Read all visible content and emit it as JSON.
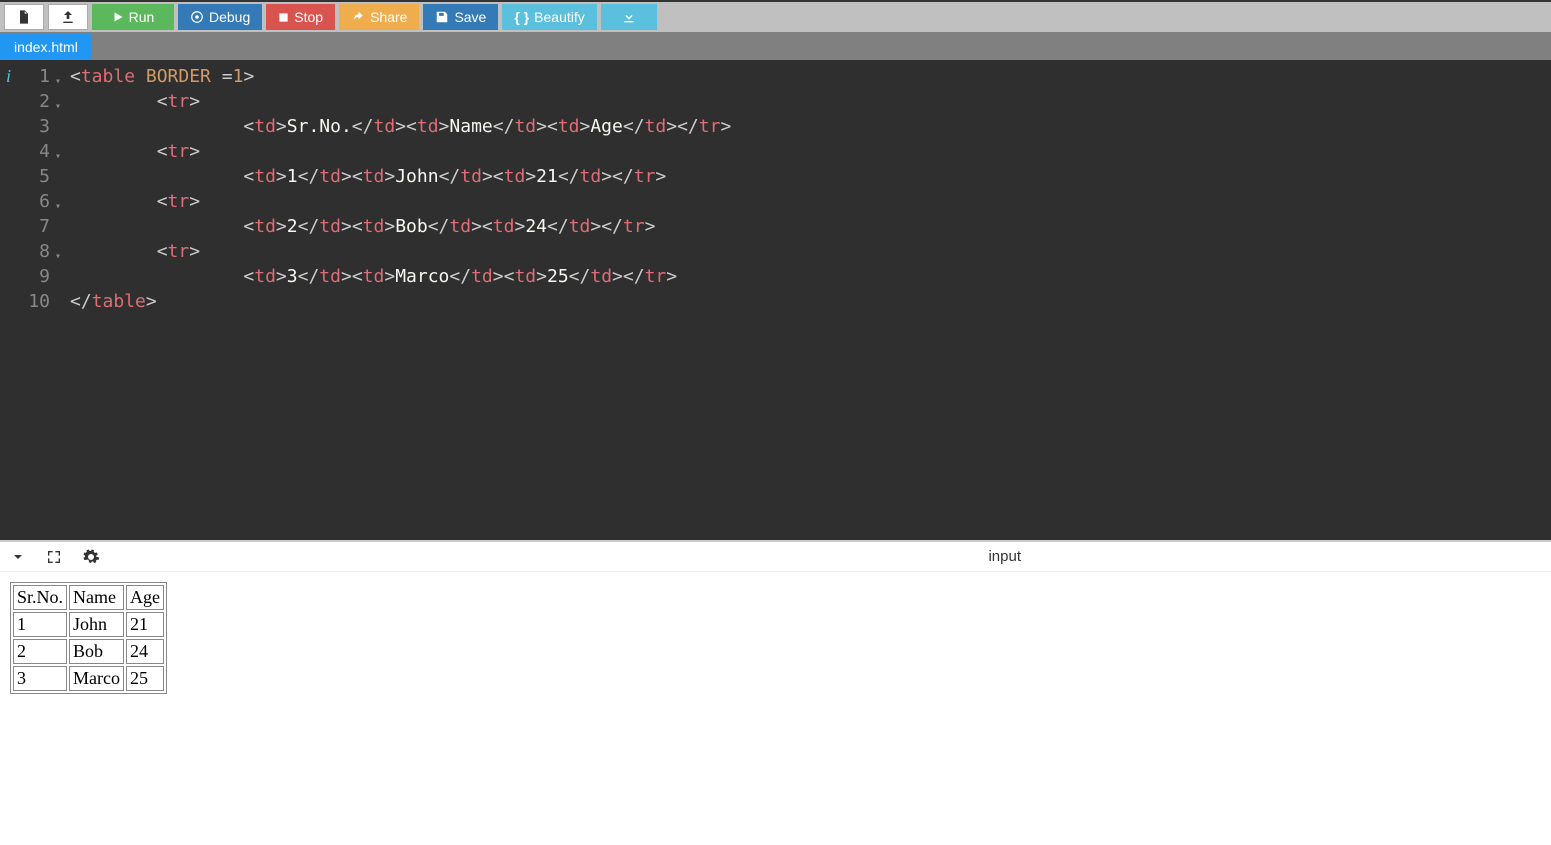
{
  "toolbar": {
    "run": "Run",
    "debug": "Debug",
    "stop": "Stop",
    "share": "Share",
    "save": "Save",
    "beautify": "Beautify"
  },
  "tab": {
    "name": "index.html"
  },
  "editor": {
    "lines": [
      {
        "n": "1",
        "fold": true,
        "info": true,
        "indent": 0,
        "tokens": [
          [
            "punc",
            "<"
          ],
          [
            "tag",
            "table"
          ],
          [
            "txt",
            " "
          ],
          [
            "attr",
            "BORDER"
          ],
          [
            "txt",
            " "
          ],
          [
            "punc",
            "="
          ],
          [
            "num",
            "1"
          ],
          [
            "punc",
            ">"
          ]
        ]
      },
      {
        "n": "2",
        "fold": true,
        "indent": 2,
        "tokens": [
          [
            "punc",
            "<"
          ],
          [
            "tag",
            "tr"
          ],
          [
            "punc",
            ">"
          ]
        ]
      },
      {
        "n": "3",
        "indent": 4,
        "tokens": [
          [
            "punc",
            "<"
          ],
          [
            "tag",
            "td"
          ],
          [
            "punc",
            ">"
          ],
          [
            "txt",
            "Sr.No."
          ],
          [
            "punc",
            "</"
          ],
          [
            "tag",
            "td"
          ],
          [
            "punc",
            "><"
          ],
          [
            "tag",
            "td"
          ],
          [
            "punc",
            ">"
          ],
          [
            "txt",
            "Name"
          ],
          [
            "punc",
            "</"
          ],
          [
            "tag",
            "td"
          ],
          [
            "punc",
            "><"
          ],
          [
            "tag",
            "td"
          ],
          [
            "punc",
            ">"
          ],
          [
            "txt",
            "Age"
          ],
          [
            "punc",
            "</"
          ],
          [
            "tag",
            "td"
          ],
          [
            "punc",
            "></"
          ],
          [
            "tag",
            "tr"
          ],
          [
            "punc",
            ">"
          ]
        ]
      },
      {
        "n": "4",
        "fold": true,
        "indent": 2,
        "tokens": [
          [
            "punc",
            "<"
          ],
          [
            "tag",
            "tr"
          ],
          [
            "punc",
            ">"
          ]
        ]
      },
      {
        "n": "5",
        "indent": 4,
        "tokens": [
          [
            "punc",
            "<"
          ],
          [
            "tag",
            "td"
          ],
          [
            "punc",
            ">"
          ],
          [
            "txt",
            "1"
          ],
          [
            "punc",
            "</"
          ],
          [
            "tag",
            "td"
          ],
          [
            "punc",
            "><"
          ],
          [
            "tag",
            "td"
          ],
          [
            "punc",
            ">"
          ],
          [
            "txt",
            "John"
          ],
          [
            "punc",
            "</"
          ],
          [
            "tag",
            "td"
          ],
          [
            "punc",
            "><"
          ],
          [
            "tag",
            "td"
          ],
          [
            "punc",
            ">"
          ],
          [
            "txt",
            "21"
          ],
          [
            "punc",
            "</"
          ],
          [
            "tag",
            "td"
          ],
          [
            "punc",
            "></"
          ],
          [
            "tag",
            "tr"
          ],
          [
            "punc",
            ">"
          ]
        ]
      },
      {
        "n": "6",
        "fold": true,
        "indent": 2,
        "tokens": [
          [
            "punc",
            "<"
          ],
          [
            "tag",
            "tr"
          ],
          [
            "punc",
            ">"
          ]
        ]
      },
      {
        "n": "7",
        "indent": 4,
        "tokens": [
          [
            "punc",
            "<"
          ],
          [
            "tag",
            "td"
          ],
          [
            "punc",
            ">"
          ],
          [
            "txt",
            "2"
          ],
          [
            "punc",
            "</"
          ],
          [
            "tag",
            "td"
          ],
          [
            "punc",
            "><"
          ],
          [
            "tag",
            "td"
          ],
          [
            "punc",
            ">"
          ],
          [
            "txt",
            "Bob"
          ],
          [
            "punc",
            "</"
          ],
          [
            "tag",
            "td"
          ],
          [
            "punc",
            "><"
          ],
          [
            "tag",
            "td"
          ],
          [
            "punc",
            ">"
          ],
          [
            "txt",
            "24"
          ],
          [
            "punc",
            "</"
          ],
          [
            "tag",
            "td"
          ],
          [
            "punc",
            "></"
          ],
          [
            "tag",
            "tr"
          ],
          [
            "punc",
            ">"
          ]
        ]
      },
      {
        "n": "8",
        "fold": true,
        "indent": 2,
        "tokens": [
          [
            "punc",
            "<"
          ],
          [
            "tag",
            "tr"
          ],
          [
            "punc",
            ">"
          ]
        ]
      },
      {
        "n": "9",
        "indent": 4,
        "tokens": [
          [
            "punc",
            "<"
          ],
          [
            "tag",
            "td"
          ],
          [
            "punc",
            ">"
          ],
          [
            "txt",
            "3"
          ],
          [
            "punc",
            "</"
          ],
          [
            "tag",
            "td"
          ],
          [
            "punc",
            "><"
          ],
          [
            "tag",
            "td"
          ],
          [
            "punc",
            ">"
          ],
          [
            "txt",
            "Marco"
          ],
          [
            "punc",
            "</"
          ],
          [
            "tag",
            "td"
          ],
          [
            "punc",
            "><"
          ],
          [
            "tag",
            "td"
          ],
          [
            "punc",
            ">"
          ],
          [
            "txt",
            "25"
          ],
          [
            "punc",
            "</"
          ],
          [
            "tag",
            "td"
          ],
          [
            "punc",
            "></"
          ],
          [
            "tag",
            "tr"
          ],
          [
            "punc",
            ">"
          ]
        ]
      },
      {
        "n": "10",
        "indent": 0,
        "tokens": [
          [
            "punc",
            "</"
          ],
          [
            "tag",
            "table"
          ],
          [
            "punc",
            ">"
          ]
        ]
      }
    ]
  },
  "outputBar": {
    "inputLabel": "input"
  },
  "outputTable": {
    "headers": [
      "Sr.No.",
      "Name",
      "Age"
    ],
    "rows": [
      [
        "1",
        "John",
        "21"
      ],
      [
        "2",
        "Bob",
        "24"
      ],
      [
        "3",
        "Marco",
        "25"
      ]
    ]
  }
}
